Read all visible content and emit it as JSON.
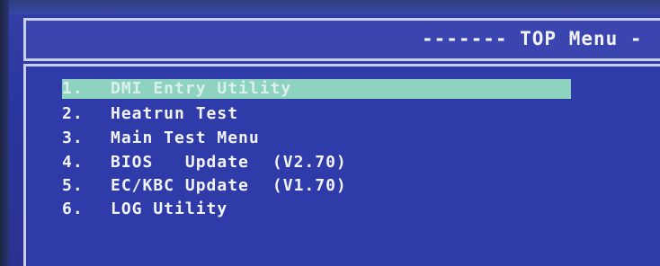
{
  "header": {
    "title": "------- TOP Menu -"
  },
  "menu": {
    "items": [
      {
        "number": "1.",
        "label": "DMI Entry Utility",
        "version": ""
      },
      {
        "number": "2.",
        "label": "Heatrun Test",
        "version": ""
      },
      {
        "number": "3.",
        "label": "Main Test Menu",
        "version": ""
      },
      {
        "number": "4.",
        "label": "BIOS   Update",
        "version": "(V2.70)"
      },
      {
        "number": "5.",
        "label": "EC/KBC Update",
        "version": "(V1.70)"
      },
      {
        "number": "6.",
        "label": "LOG Utility",
        "version": ""
      }
    ],
    "selected_index": 0
  },
  "colors": {
    "background": "#2f3ba8",
    "text": "#f3f3fa",
    "highlight": "#8ed3bf",
    "border": "#c9cfe9"
  }
}
